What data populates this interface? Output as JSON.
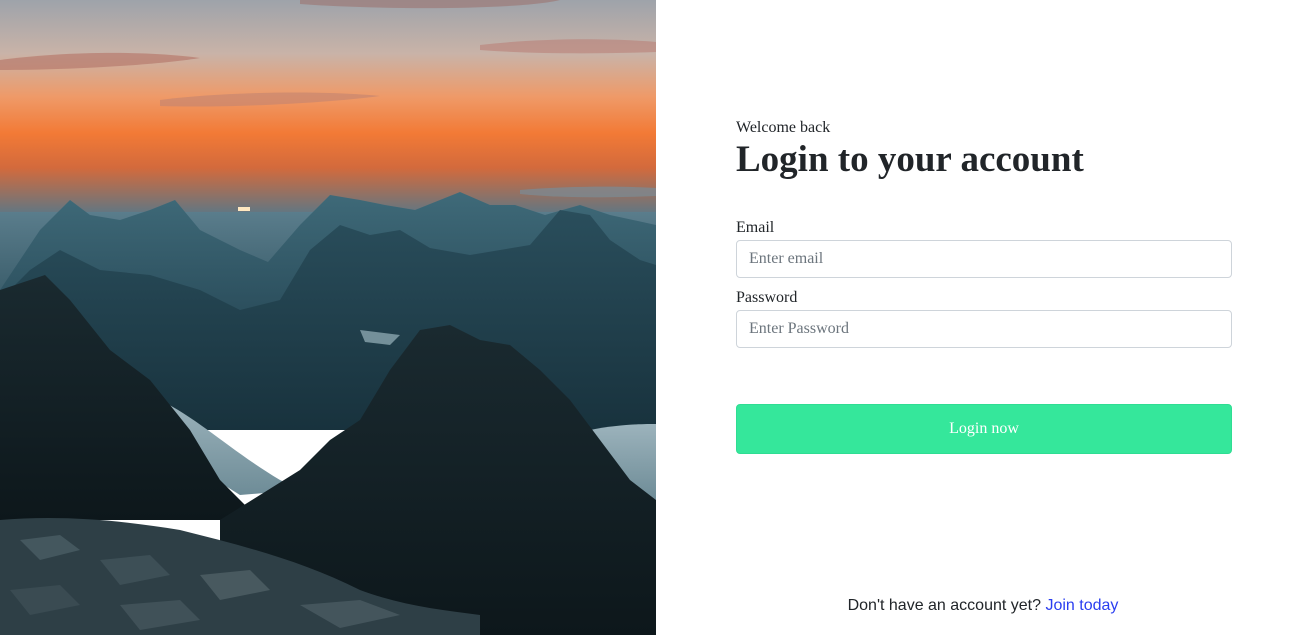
{
  "hero": {
    "image_name": "mountain-sunset-photo"
  },
  "login": {
    "welcome": "Welcome back",
    "title": "Login to your account",
    "email_label": "Email",
    "email_placeholder": "Enter email",
    "email_value": "",
    "password_label": "Password",
    "password_placeholder": "Enter Password",
    "password_value": "",
    "submit_label": "Login now"
  },
  "footer": {
    "prompt": "Don't have an account yet?",
    "link_label": "Join today"
  },
  "colors": {
    "accent_button": "#35e79b",
    "link": "#2a3ef0",
    "text": "#212529"
  }
}
